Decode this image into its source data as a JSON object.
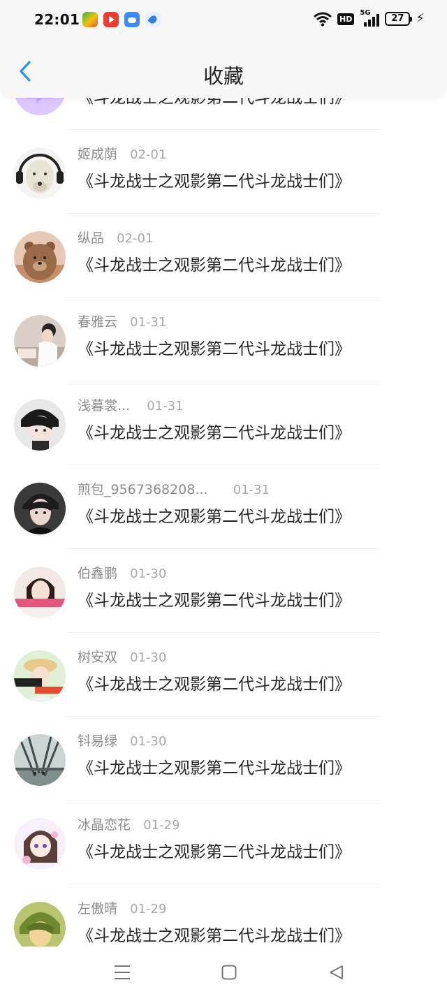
{
  "status_bar": {
    "time": "22:01",
    "app_icons": [
      "game-center-icon",
      "video-app-icon",
      "cloud-app-icon",
      "browser-app-icon"
    ],
    "network": "5G",
    "hd_label": "HD",
    "battery": "27"
  },
  "header": {
    "title": "收藏",
    "back_icon": "chevron-left-icon",
    "accent_color": "#2f8ff0"
  },
  "items": [
    {
      "name": "",
      "date": "",
      "text": "《斗龙战士之观影第二代斗龙战士们》",
      "avatar": "purple-chat-icon"
    },
    {
      "name": "姬成荫",
      "date": "02-01",
      "text": "《斗龙战士之观影第二代斗龙战士们》",
      "avatar": "dog-headphones"
    },
    {
      "name": "纵品",
      "date": "02-01",
      "text": "《斗龙战士之观影第二代斗龙战士们》",
      "avatar": "bear"
    },
    {
      "name": "春雅云",
      "date": "01-31",
      "text": "《斗龙战士之观影第二代斗龙战士们》",
      "avatar": "girl-desk"
    },
    {
      "name": "浅暮裳...",
      "date": "01-31",
      "text": "《斗龙战士之观影第二代斗龙战士们》",
      "avatar": "anime-boy"
    },
    {
      "name": "煎包_9567368208...",
      "date": "01-31",
      "text": "《斗龙战士之观影第二代斗龙战士们》",
      "avatar": "anime-man"
    },
    {
      "name": "伯鑫鹏",
      "date": "01-30",
      "text": "《斗龙战士之观影第二代斗龙战士们》",
      "avatar": "girl-photo"
    },
    {
      "name": "树安双",
      "date": "01-30",
      "text": "《斗龙战士之观影第二代斗龙战士们》",
      "avatar": "girl-hat"
    },
    {
      "name": "钭易绿",
      "date": "01-30",
      "text": "《斗龙战士之观影第二代斗龙战士们》",
      "avatar": "bridge"
    },
    {
      "name": "冰晶恋花",
      "date": "01-29",
      "text": "《斗龙战士之观影第二代斗龙战士们》",
      "avatar": "anime-girl"
    },
    {
      "name": "左傲晴",
      "date": "01-29",
      "text": "《斗龙战士之观影第二代斗龙战士们》",
      "avatar": "anime-green"
    }
  ],
  "nav": {
    "menu_icon": "menu-icon",
    "home_icon": "home-square-icon",
    "back_icon": "back-triangle-icon"
  }
}
